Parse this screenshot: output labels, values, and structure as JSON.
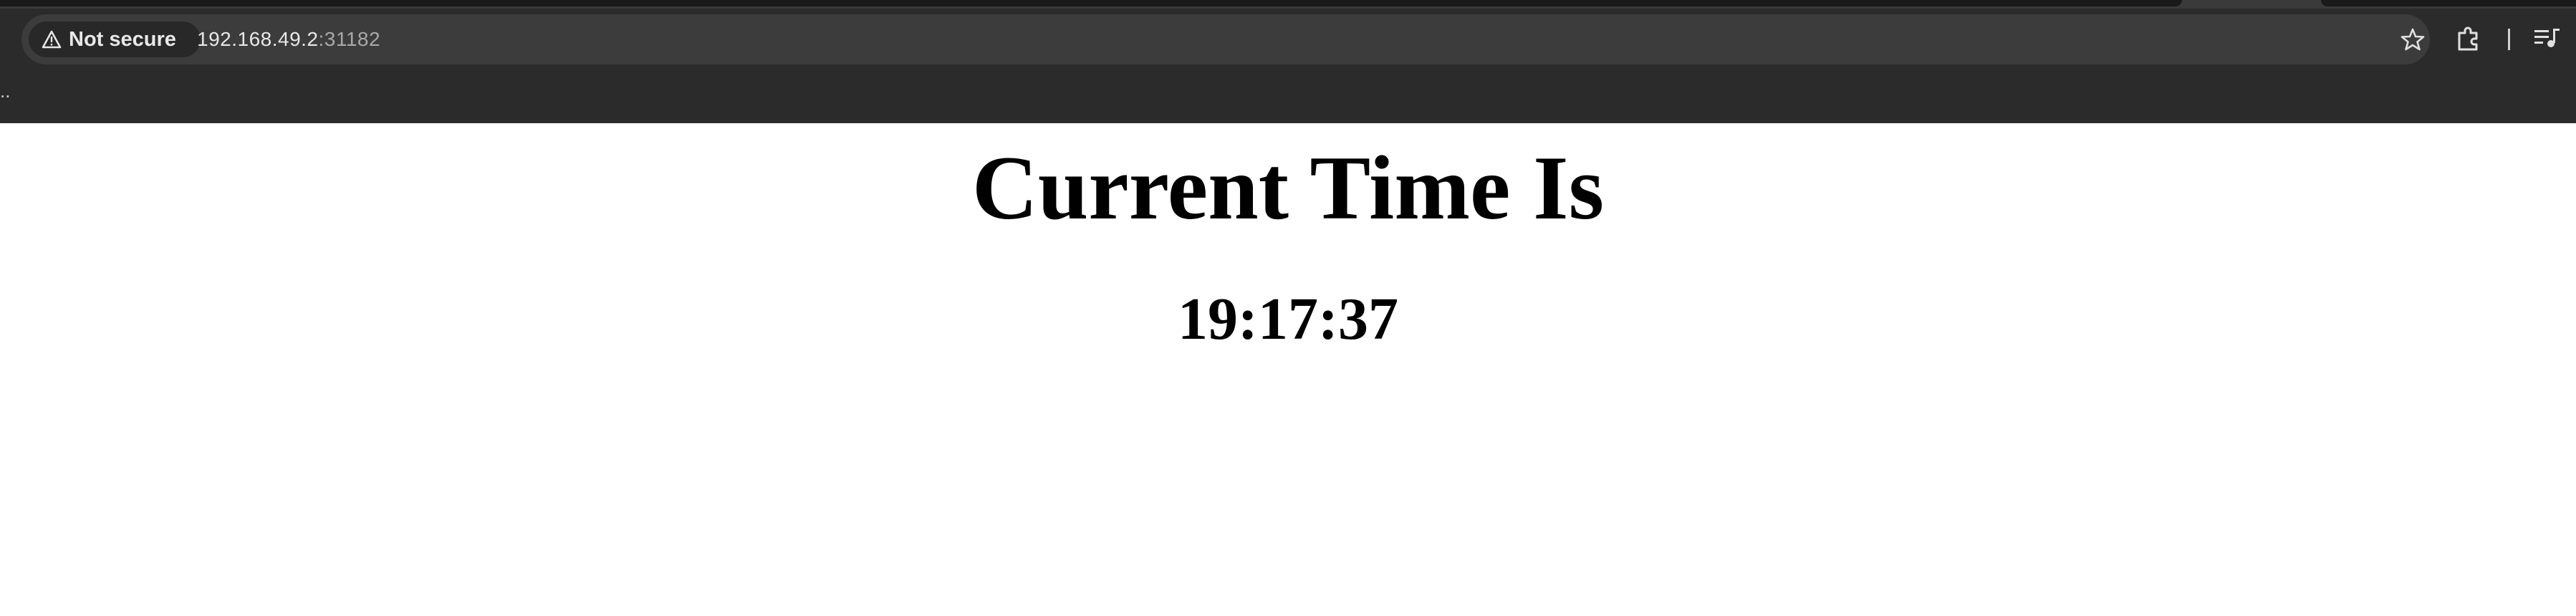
{
  "browser": {
    "security_label": "Not secure",
    "url_host": "192.168.49.2",
    "url_port": ":31182",
    "bookmarks_overflow": "..",
    "icons": {
      "security": "warning-triangle-icon",
      "bookmark": "star-icon",
      "extensions": "puzzle-icon",
      "media": "media-queue-icon"
    }
  },
  "page": {
    "heading": "Current Time Is",
    "time": "19:17:37"
  }
}
